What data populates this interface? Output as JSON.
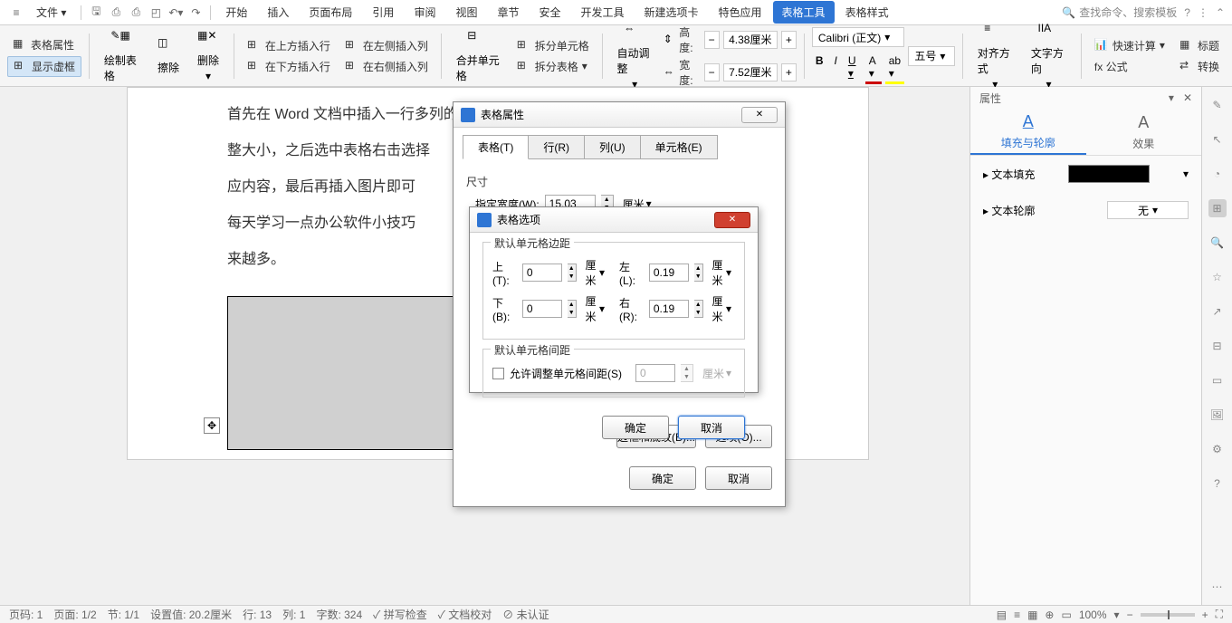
{
  "menu": {
    "file": "文件",
    "tabs": [
      "开始",
      "插入",
      "页面布局",
      "引用",
      "审阅",
      "视图",
      "章节",
      "安全",
      "开发工具",
      "新建选项卡",
      "特色应用",
      "表格工具",
      "表格样式"
    ],
    "search": "查找命令、搜索模板"
  },
  "ribbon": {
    "table_props": "表格属性",
    "show_grid": "显示虚框",
    "draw": "绘制表格",
    "erase": "擦除",
    "delete": "删除",
    "ins_above": "在上方插入行",
    "ins_below": "在下方插入行",
    "ins_left": "在左侧插入列",
    "ins_right": "在右侧插入列",
    "merge": "合并单元格",
    "split_cell": "拆分单元格",
    "split_table": "拆分表格",
    "autofit": "自动调整",
    "height_lbl": "高度:",
    "width_lbl": "宽度:",
    "height_val": "4.38厘米",
    "width_val": "7.52厘米",
    "font": "Calibri (正文)",
    "fontsize": "五号",
    "align": "对齐方式",
    "textdir": "文字方向",
    "quickcalc": "快速计算",
    "title_row": "标题",
    "formula": "fx 公式",
    "convert": "转换"
  },
  "doc": {
    "l1": "首先在 Word 文档中插入一行多列的表格，并根据图片大小的需要调",
    "l2": "整大小，之后选中表格右击选择",
    "l3": "应内容，最后再插入图片即可",
    "l4": "每天学习一点办公软件小技巧",
    "l5": "来越多。"
  },
  "dlg1": {
    "title": "表格属性",
    "tabs": {
      "table": "表格(T)",
      "row": "行(R)",
      "col": "列(U)",
      "cell": "单元格(E)"
    },
    "size_lbl": "尺寸",
    "spec_width": "指定宽度(W):",
    "width_val": "15.03",
    "unit": "厘米",
    "border_btn": "边框和底纹(B)...",
    "options_btn": "选项(O)...",
    "ok": "确定",
    "cancel": "取消"
  },
  "dlg2": {
    "title": "表格选项",
    "margins_lbl": "默认单元格边距",
    "spacing_lbl": "默认单元格间距",
    "top": "上(T):",
    "bottom": "下(B):",
    "left": "左(L):",
    "right": "右(R):",
    "t_val": "0",
    "b_val": "0",
    "l_val": "0.19",
    "r_val": "0.19",
    "unit": "厘米",
    "allow_spacing": "允许调整单元格间距(S)",
    "sp_val": "0",
    "ok": "确定",
    "cancel": "取消"
  },
  "rpanel": {
    "title": "属性",
    "t1": "填充与轮廓",
    "t2": "效果",
    "text_fill": "文本填充",
    "text_outline": "文本轮廓",
    "none": "无"
  },
  "status": {
    "page": "页码: 1",
    "pages": "页面: 1/2",
    "sect": "节: 1/1",
    "pos": "设置值: 20.2厘米",
    "row": "行: 13",
    "col": "列: 1",
    "words": "字数: 324",
    "spell": "拼写检查",
    "proof": "文档校对",
    "unauth": "未认证",
    "zoom": "100%"
  }
}
